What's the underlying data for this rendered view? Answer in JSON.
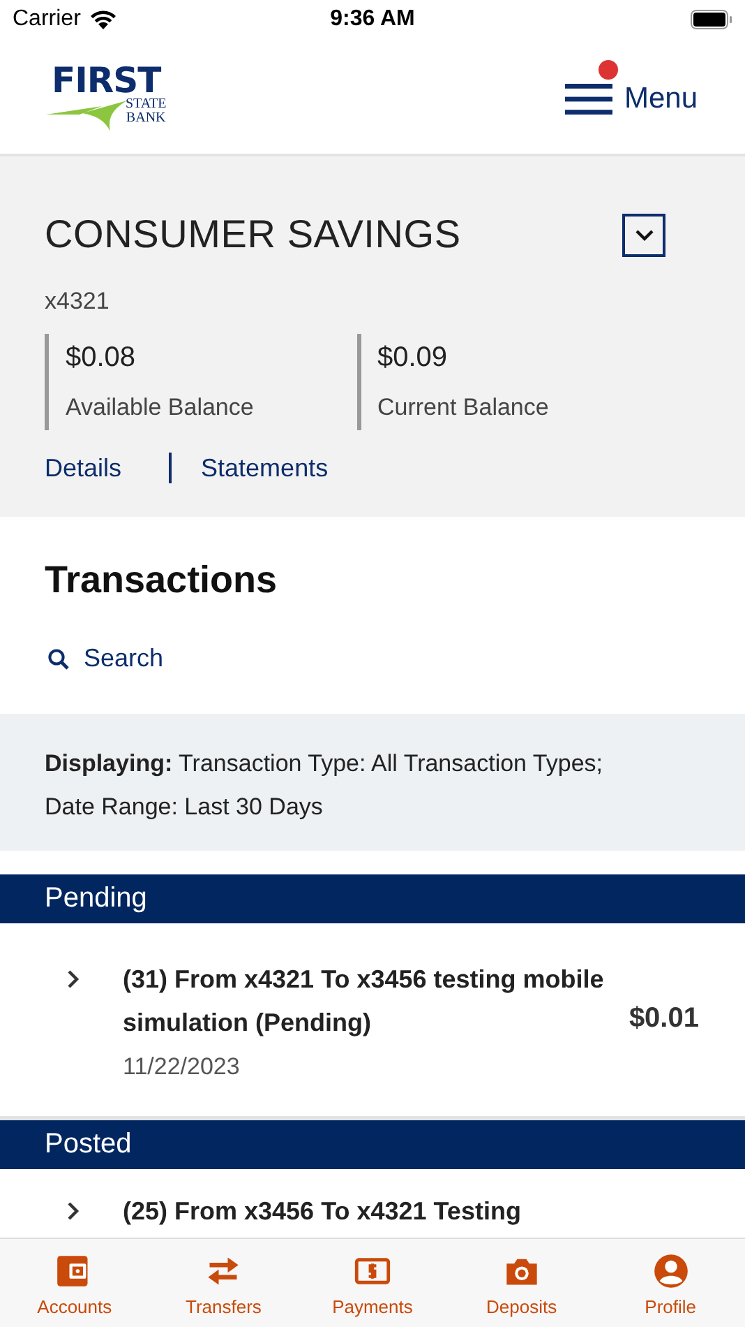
{
  "status_bar": {
    "carrier": "Carrier",
    "time": "9:36 AM"
  },
  "header": {
    "logo": {
      "line1": "FIRST",
      "line2": "STATE",
      "line3": "BANK"
    },
    "menu": {
      "label": "Menu",
      "notification": true
    }
  },
  "account": {
    "name": "CONSUMER SAVINGS",
    "number": "x4321",
    "balances": [
      {
        "amount": "$0.08",
        "label": "Available Balance"
      },
      {
        "amount": "$0.09",
        "label": "Current Balance"
      }
    ],
    "links": [
      "Details",
      "Statements"
    ]
  },
  "transactions": {
    "title": "Transactions",
    "search": "Search",
    "filter": "**Displaying:** Transaction Type: All Transaction Types; Date Range: Last 30 Days"
  },
  "sections": [
    {
      "title": "Pending",
      "items": [
        {
          "description": "(31) From x4321 To x3456 testing mobile simulation (Pending)",
          "date": "11/22/2023",
          "amount": "$0.01"
        }
      ]
    },
    {
      "title": "Posted",
      "items": [
        {
          "description": "(25) From x3456 To x4321 Testing"
        }
      ]
    }
  ],
  "tab_bar": [
    {
      "kind": "wallet",
      "label": "Accounts"
    },
    {
      "kind": "transfer",
      "label": "Transfers"
    },
    {
      "kind": "payment",
      "label": "Payments"
    },
    {
      "kind": "camera",
      "label": "Deposits"
    },
    {
      "kind": "person",
      "label": "Profile"
    }
  ]
}
